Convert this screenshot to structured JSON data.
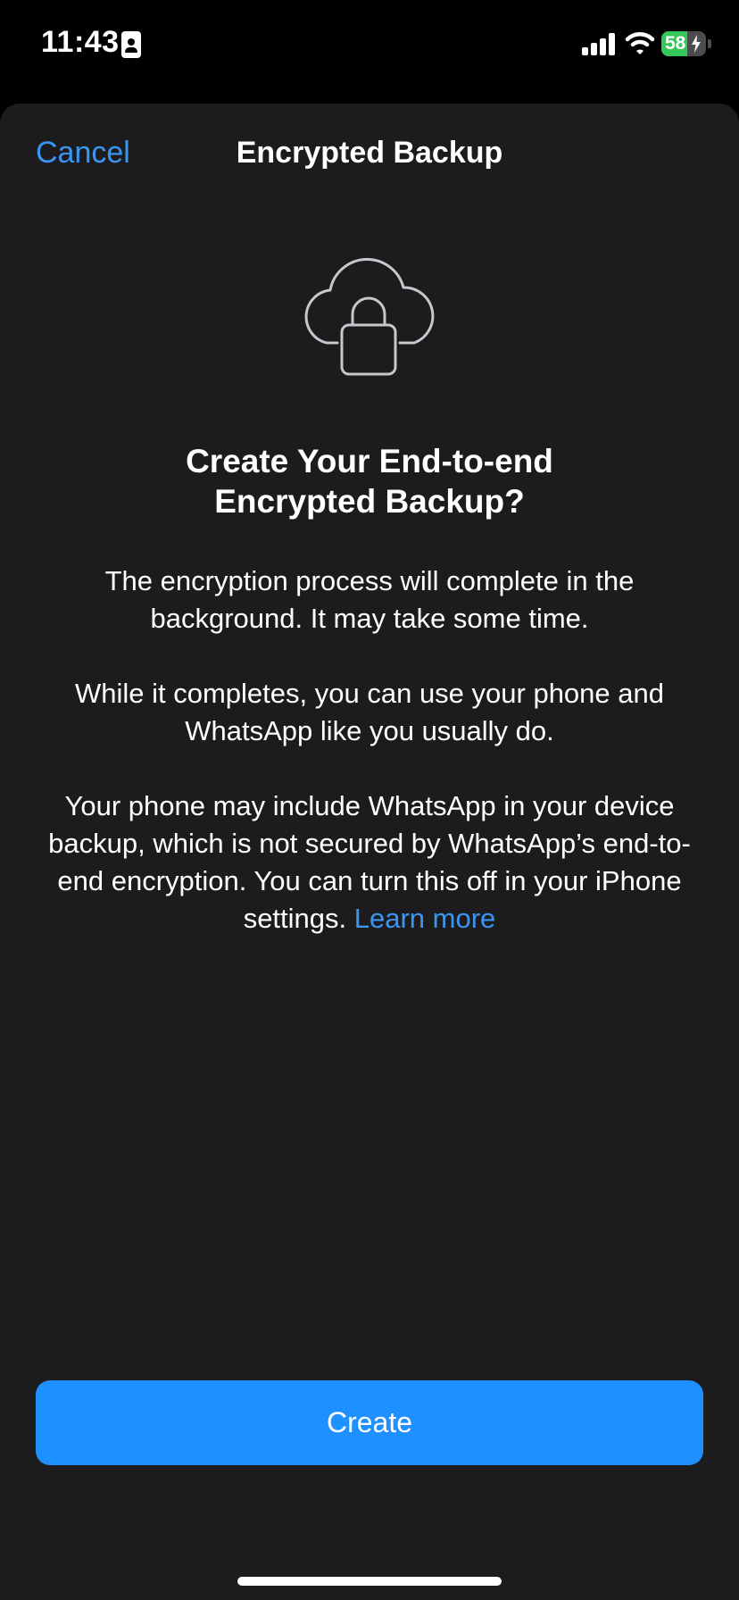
{
  "status_bar": {
    "time": "11:43",
    "battery_percent": "58",
    "battery_level": 0.58,
    "icons": [
      "id-card-icon",
      "signal-icon",
      "wifi-icon",
      "battery-icon",
      "charging-bolt-icon"
    ]
  },
  "nav": {
    "cancel_label": "Cancel",
    "title": "Encrypted Backup"
  },
  "hero_icon": "cloud-lock-icon",
  "content": {
    "heading_line1": "Create Your End-to-end",
    "heading_line2": "Encrypted Backup?",
    "para1": "The encryption process will complete in the background. It may take some time.",
    "para2": "While it completes, you can use your phone and WhatsApp like you usually do.",
    "para3": "Your phone may include WhatsApp in your device backup, which is not secured by WhatsApp’s end-to-end encryption. You can turn this off in your iPhone settings.",
    "learn_more": "Learn more"
  },
  "create_button_label": "Create",
  "colors": {
    "accent": "#3a96f0",
    "button": "#1e90ff",
    "sheet_background": "#1c1c1e",
    "battery_green": "#34c759"
  }
}
